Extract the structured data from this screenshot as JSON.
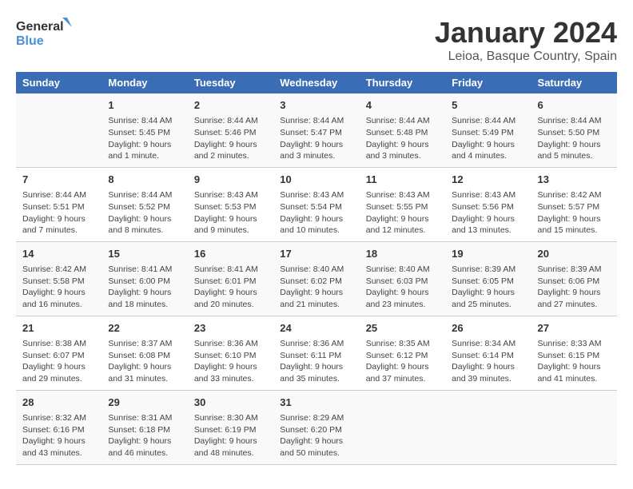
{
  "logo": {
    "line1": "General",
    "line2": "Blue"
  },
  "title": "January 2024",
  "subtitle": "Leioa, Basque Country, Spain",
  "headers": [
    "Sunday",
    "Monday",
    "Tuesday",
    "Wednesday",
    "Thursday",
    "Friday",
    "Saturday"
  ],
  "weeks": [
    [
      {
        "day": "",
        "sunrise": "",
        "sunset": "",
        "daylight": ""
      },
      {
        "day": "1",
        "sunrise": "Sunrise: 8:44 AM",
        "sunset": "Sunset: 5:45 PM",
        "daylight": "Daylight: 9 hours and 1 minute."
      },
      {
        "day": "2",
        "sunrise": "Sunrise: 8:44 AM",
        "sunset": "Sunset: 5:46 PM",
        "daylight": "Daylight: 9 hours and 2 minutes."
      },
      {
        "day": "3",
        "sunrise": "Sunrise: 8:44 AM",
        "sunset": "Sunset: 5:47 PM",
        "daylight": "Daylight: 9 hours and 3 minutes."
      },
      {
        "day": "4",
        "sunrise": "Sunrise: 8:44 AM",
        "sunset": "Sunset: 5:48 PM",
        "daylight": "Daylight: 9 hours and 3 minutes."
      },
      {
        "day": "5",
        "sunrise": "Sunrise: 8:44 AM",
        "sunset": "Sunset: 5:49 PM",
        "daylight": "Daylight: 9 hours and 4 minutes."
      },
      {
        "day": "6",
        "sunrise": "Sunrise: 8:44 AM",
        "sunset": "Sunset: 5:50 PM",
        "daylight": "Daylight: 9 hours and 5 minutes."
      }
    ],
    [
      {
        "day": "7",
        "sunrise": "Sunrise: 8:44 AM",
        "sunset": "Sunset: 5:51 PM",
        "daylight": "Daylight: 9 hours and 7 minutes."
      },
      {
        "day": "8",
        "sunrise": "Sunrise: 8:44 AM",
        "sunset": "Sunset: 5:52 PM",
        "daylight": "Daylight: 9 hours and 8 minutes."
      },
      {
        "day": "9",
        "sunrise": "Sunrise: 8:43 AM",
        "sunset": "Sunset: 5:53 PM",
        "daylight": "Daylight: 9 hours and 9 minutes."
      },
      {
        "day": "10",
        "sunrise": "Sunrise: 8:43 AM",
        "sunset": "Sunset: 5:54 PM",
        "daylight": "Daylight: 9 hours and 10 minutes."
      },
      {
        "day": "11",
        "sunrise": "Sunrise: 8:43 AM",
        "sunset": "Sunset: 5:55 PM",
        "daylight": "Daylight: 9 hours and 12 minutes."
      },
      {
        "day": "12",
        "sunrise": "Sunrise: 8:43 AM",
        "sunset": "Sunset: 5:56 PM",
        "daylight": "Daylight: 9 hours and 13 minutes."
      },
      {
        "day": "13",
        "sunrise": "Sunrise: 8:42 AM",
        "sunset": "Sunset: 5:57 PM",
        "daylight": "Daylight: 9 hours and 15 minutes."
      }
    ],
    [
      {
        "day": "14",
        "sunrise": "Sunrise: 8:42 AM",
        "sunset": "Sunset: 5:58 PM",
        "daylight": "Daylight: 9 hours and 16 minutes."
      },
      {
        "day": "15",
        "sunrise": "Sunrise: 8:41 AM",
        "sunset": "Sunset: 6:00 PM",
        "daylight": "Daylight: 9 hours and 18 minutes."
      },
      {
        "day": "16",
        "sunrise": "Sunrise: 8:41 AM",
        "sunset": "Sunset: 6:01 PM",
        "daylight": "Daylight: 9 hours and 20 minutes."
      },
      {
        "day": "17",
        "sunrise": "Sunrise: 8:40 AM",
        "sunset": "Sunset: 6:02 PM",
        "daylight": "Daylight: 9 hours and 21 minutes."
      },
      {
        "day": "18",
        "sunrise": "Sunrise: 8:40 AM",
        "sunset": "Sunset: 6:03 PM",
        "daylight": "Daylight: 9 hours and 23 minutes."
      },
      {
        "day": "19",
        "sunrise": "Sunrise: 8:39 AM",
        "sunset": "Sunset: 6:05 PM",
        "daylight": "Daylight: 9 hours and 25 minutes."
      },
      {
        "day": "20",
        "sunrise": "Sunrise: 8:39 AM",
        "sunset": "Sunset: 6:06 PM",
        "daylight": "Daylight: 9 hours and 27 minutes."
      }
    ],
    [
      {
        "day": "21",
        "sunrise": "Sunrise: 8:38 AM",
        "sunset": "Sunset: 6:07 PM",
        "daylight": "Daylight: 9 hours and 29 minutes."
      },
      {
        "day": "22",
        "sunrise": "Sunrise: 8:37 AM",
        "sunset": "Sunset: 6:08 PM",
        "daylight": "Daylight: 9 hours and 31 minutes."
      },
      {
        "day": "23",
        "sunrise": "Sunrise: 8:36 AM",
        "sunset": "Sunset: 6:10 PM",
        "daylight": "Daylight: 9 hours and 33 minutes."
      },
      {
        "day": "24",
        "sunrise": "Sunrise: 8:36 AM",
        "sunset": "Sunset: 6:11 PM",
        "daylight": "Daylight: 9 hours and 35 minutes."
      },
      {
        "day": "25",
        "sunrise": "Sunrise: 8:35 AM",
        "sunset": "Sunset: 6:12 PM",
        "daylight": "Daylight: 9 hours and 37 minutes."
      },
      {
        "day": "26",
        "sunrise": "Sunrise: 8:34 AM",
        "sunset": "Sunset: 6:14 PM",
        "daylight": "Daylight: 9 hours and 39 minutes."
      },
      {
        "day": "27",
        "sunrise": "Sunrise: 8:33 AM",
        "sunset": "Sunset: 6:15 PM",
        "daylight": "Daylight: 9 hours and 41 minutes."
      }
    ],
    [
      {
        "day": "28",
        "sunrise": "Sunrise: 8:32 AM",
        "sunset": "Sunset: 6:16 PM",
        "daylight": "Daylight: 9 hours and 43 minutes."
      },
      {
        "day": "29",
        "sunrise": "Sunrise: 8:31 AM",
        "sunset": "Sunset: 6:18 PM",
        "daylight": "Daylight: 9 hours and 46 minutes."
      },
      {
        "day": "30",
        "sunrise": "Sunrise: 8:30 AM",
        "sunset": "Sunset: 6:19 PM",
        "daylight": "Daylight: 9 hours and 48 minutes."
      },
      {
        "day": "31",
        "sunrise": "Sunrise: 8:29 AM",
        "sunset": "Sunset: 6:20 PM",
        "daylight": "Daylight: 9 hours and 50 minutes."
      },
      {
        "day": "",
        "sunrise": "",
        "sunset": "",
        "daylight": ""
      },
      {
        "day": "",
        "sunrise": "",
        "sunset": "",
        "daylight": ""
      },
      {
        "day": "",
        "sunrise": "",
        "sunset": "",
        "daylight": ""
      }
    ]
  ]
}
